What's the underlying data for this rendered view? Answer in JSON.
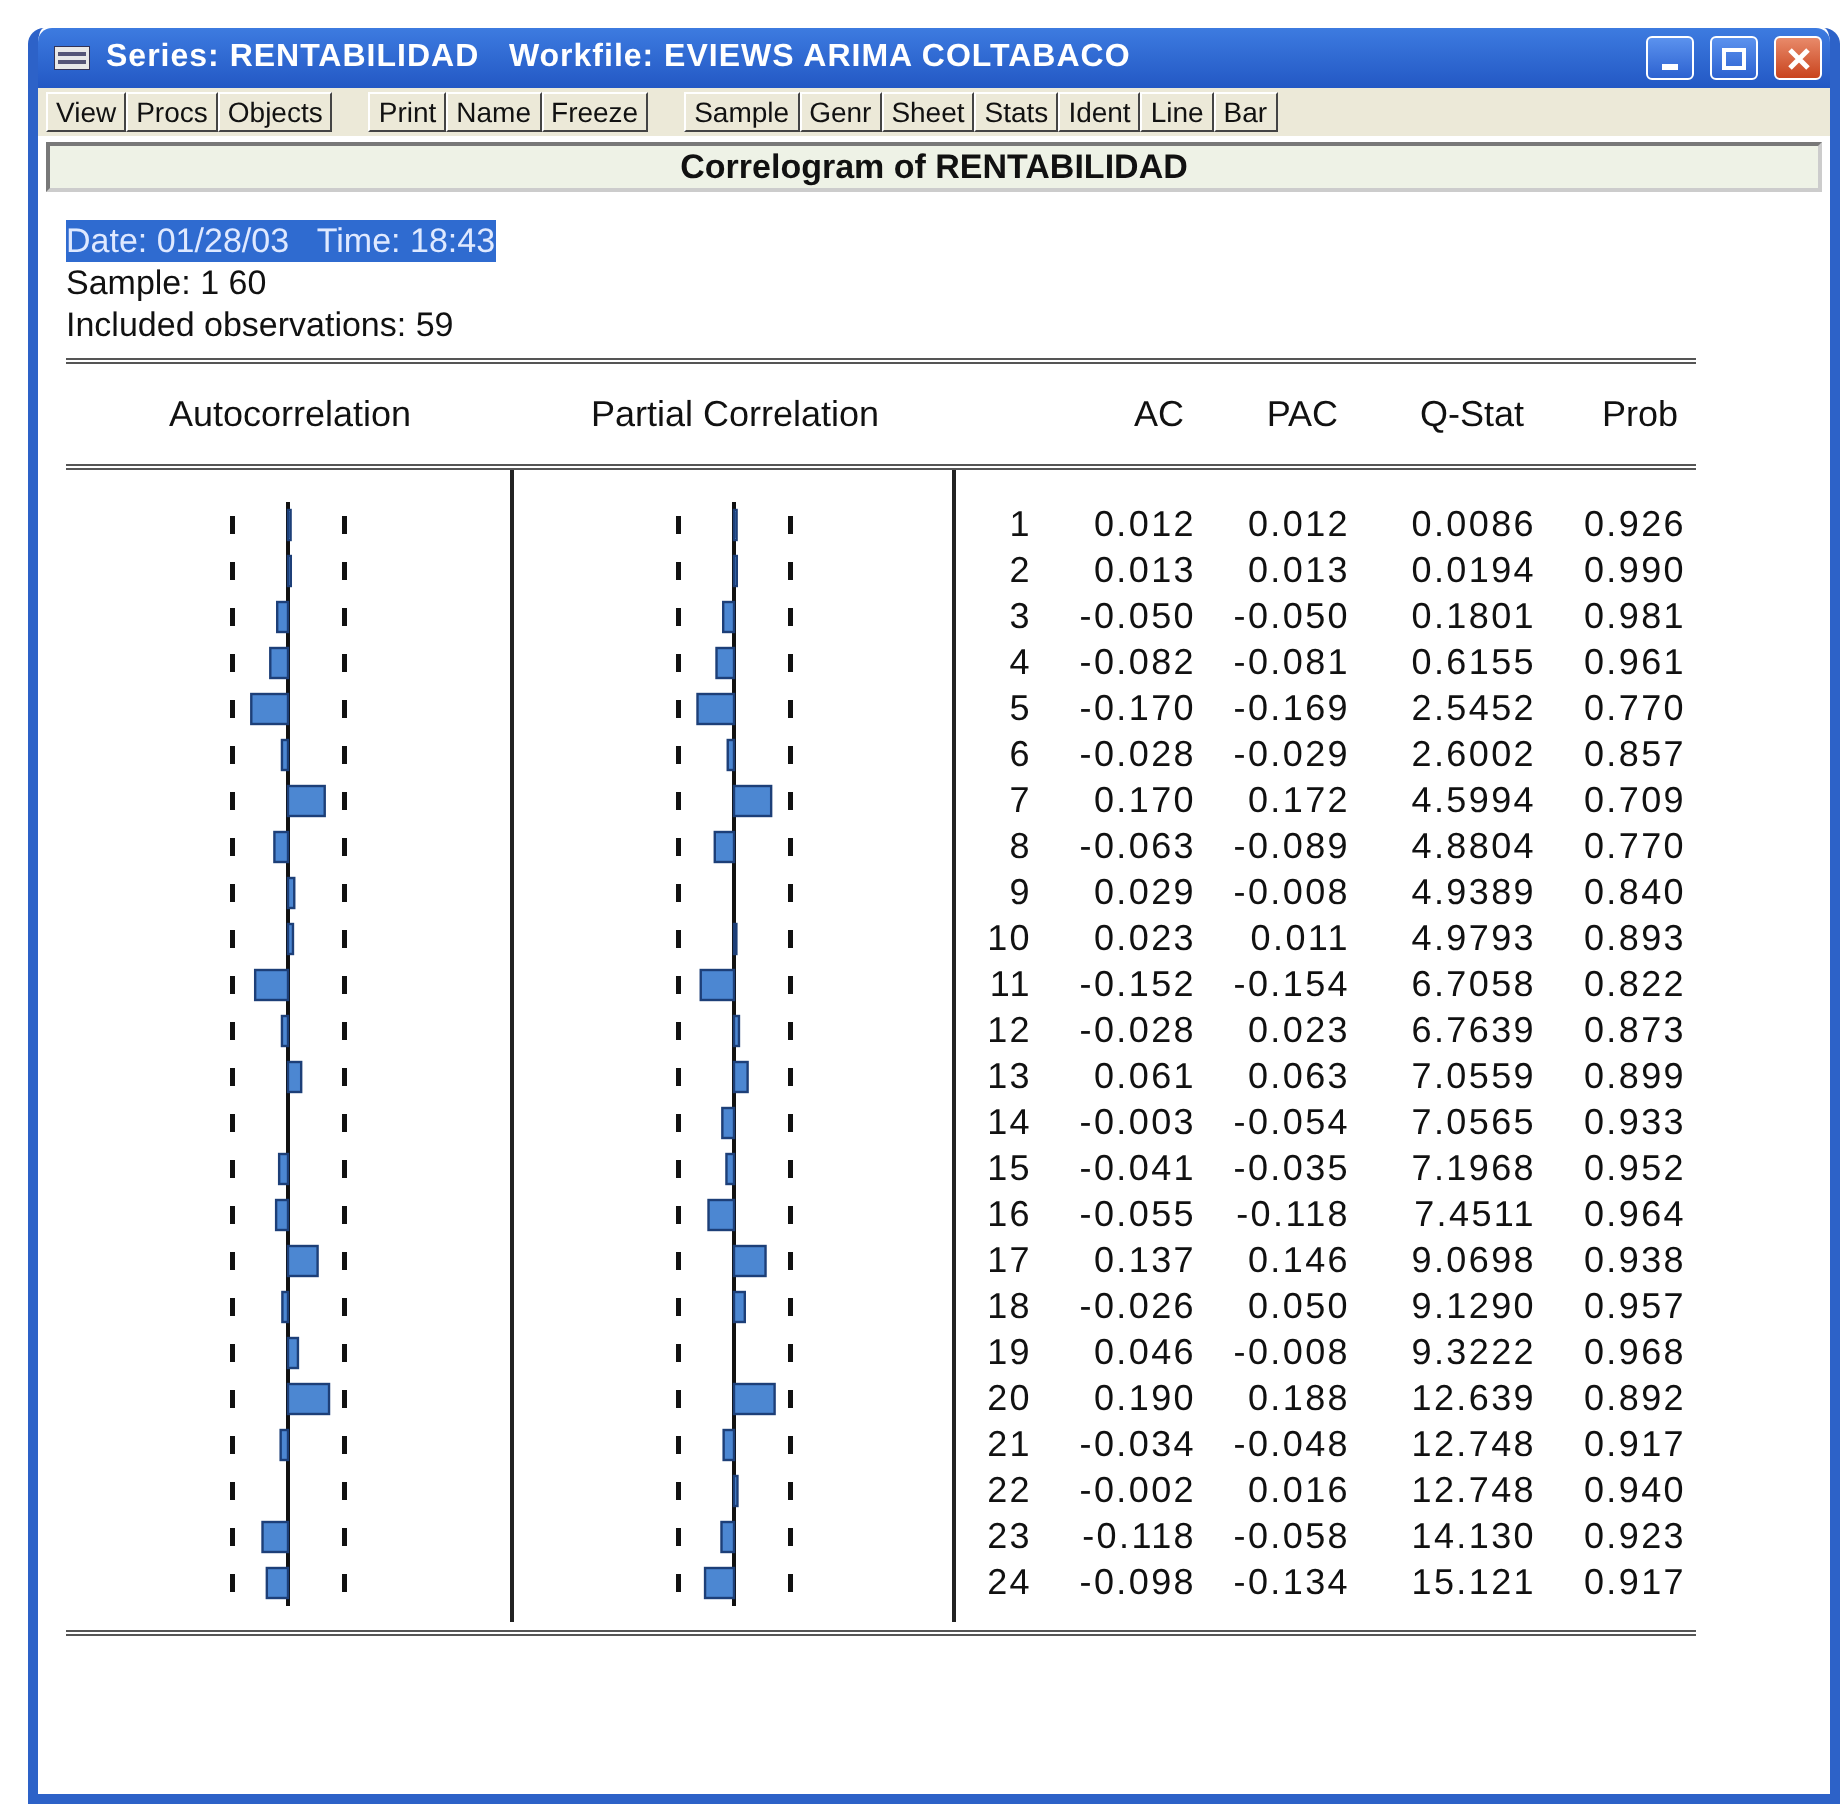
{
  "window": {
    "title": "Series: RENTABILIDAD   Workfile: EVIEWS ARIMA COLTABACO"
  },
  "toolbar": [
    [
      "View",
      "Procs",
      "Objects"
    ],
    [
      "Print",
      "Name",
      "Freeze"
    ],
    [
      "Sample",
      "Genr",
      "Sheet",
      "Stats",
      "Ident",
      "Line",
      "Bar"
    ]
  ],
  "view_title": "Correlogram of RENTABILIDAD",
  "info_lines": [
    {
      "text": "Date: 01/28/03   Time: 18:43",
      "selected": true
    },
    {
      "text": "Sample: 1 60",
      "selected": false
    },
    {
      "text": "Included observations: 59",
      "selected": false
    }
  ],
  "table": {
    "columns": [
      "Autocorrelation",
      "Partial Correlation",
      "AC",
      "PAC",
      "Q-Stat",
      "Prob"
    ],
    "rows": [
      {
        "lag": "1",
        "ac": "0.012",
        "pac": "0.012",
        "q_stat": "0.0086",
        "prob": "0.926"
      },
      {
        "lag": "2",
        "ac": "0.013",
        "pac": "0.013",
        "q_stat": "0.0194",
        "prob": "0.990"
      },
      {
        "lag": "3",
        "ac": "-0.050",
        "pac": "-0.050",
        "q_stat": "0.1801",
        "prob": "0.981"
      },
      {
        "lag": "4",
        "ac": "-0.082",
        "pac": "-0.081",
        "q_stat": "0.6155",
        "prob": "0.961"
      },
      {
        "lag": "5",
        "ac": "-0.170",
        "pac": "-0.169",
        "q_stat": "2.5452",
        "prob": "0.770"
      },
      {
        "lag": "6",
        "ac": "-0.028",
        "pac": "-0.029",
        "q_stat": "2.6002",
        "prob": "0.857"
      },
      {
        "lag": "7",
        "ac": "0.170",
        "pac": "0.172",
        "q_stat": "4.5994",
        "prob": "0.709"
      },
      {
        "lag": "8",
        "ac": "-0.063",
        "pac": "-0.089",
        "q_stat": "4.8804",
        "prob": "0.770"
      },
      {
        "lag": "9",
        "ac": "0.029",
        "pac": "-0.008",
        "q_stat": "4.9389",
        "prob": "0.840"
      },
      {
        "lag": "10",
        "ac": "0.023",
        "pac": "0.011",
        "q_stat": "4.9793",
        "prob": "0.893"
      },
      {
        "lag": "11",
        "ac": "-0.152",
        "pac": "-0.154",
        "q_stat": "6.7058",
        "prob": "0.822"
      },
      {
        "lag": "12",
        "ac": "-0.028",
        "pac": "0.023",
        "q_stat": "6.7639",
        "prob": "0.873"
      },
      {
        "lag": "13",
        "ac": "0.061",
        "pac": "0.063",
        "q_stat": "7.0559",
        "prob": "0.899"
      },
      {
        "lag": "14",
        "ac": "-0.003",
        "pac": "-0.054",
        "q_stat": "7.0565",
        "prob": "0.933"
      },
      {
        "lag": "15",
        "ac": "-0.041",
        "pac": "-0.035",
        "q_stat": "7.1968",
        "prob": "0.952"
      },
      {
        "lag": "16",
        "ac": "-0.055",
        "pac": "-0.118",
        "q_stat": "7.4511",
        "prob": "0.964"
      },
      {
        "lag": "17",
        "ac": "0.137",
        "pac": "0.146",
        "q_stat": "9.0698",
        "prob": "0.938"
      },
      {
        "lag": "18",
        "ac": "-0.026",
        "pac": "0.050",
        "q_stat": "9.1290",
        "prob": "0.957"
      },
      {
        "lag": "19",
        "ac": "0.046",
        "pac": "-0.008",
        "q_stat": "9.3222",
        "prob": "0.968"
      },
      {
        "lag": "20",
        "ac": "0.190",
        "pac": "0.188",
        "q_stat": "12.639",
        "prob": "0.892"
      },
      {
        "lag": "21",
        "ac": "-0.034",
        "pac": "-0.048",
        "q_stat": "12.748",
        "prob": "0.917"
      },
      {
        "lag": "22",
        "ac": "-0.002",
        "pac": "0.016",
        "q_stat": "12.748",
        "prob": "0.940"
      },
      {
        "lag": "23",
        "ac": "-0.118",
        "pac": "-0.058",
        "q_stat": "14.130",
        "prob": "0.923"
      },
      {
        "lag": "24",
        "ac": "-0.098",
        "pac": "-0.134",
        "q_stat": "15.121",
        "prob": "0.917"
      }
    ]
  }
}
